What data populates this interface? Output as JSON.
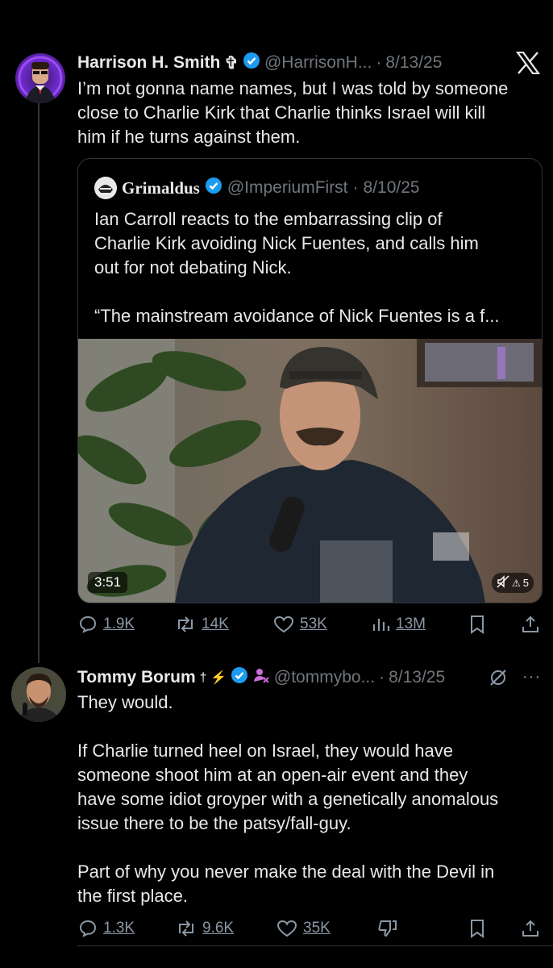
{
  "tweet1": {
    "name": "Harrison H. Smith",
    "name_glyph": "✞",
    "handle": "@HarrisonH...",
    "sep": "·",
    "date": "8/13/25",
    "text": "I’m not gonna name names, but I was told by someone\nclose to Charlie Kirk that Charlie thinks Israel will kill\nhim if he turns against them.",
    "quote": {
      "name": "Grimaldus",
      "handle": "@ImperiumFirst",
      "sep": "·",
      "date": "8/10/25",
      "text": "Ian Carroll reacts to the embarrassing clip of\nCharlie Kirk avoiding Nick Fuentes, and calls him\nout for not debating Nick.\n\n“The mainstream avoidance of Nick Fuentes is a f...",
      "video_duration": "3:51",
      "mute_count": "5"
    },
    "actions": {
      "replies": "1.9K",
      "reposts": "14K",
      "likes": "53K",
      "views": "13M"
    }
  },
  "tweet2": {
    "name": "Tommy Borum",
    "name_glyphs": "† ⚡",
    "handle": "@tommybo...",
    "sep": "·",
    "date": "8/13/25",
    "text": "They would.\n\nIf Charlie turned heel on Israel, they would have\nsomeone shoot him at an open-air event and they\nhave some idiot groyper with a genetically anomalous\nissue there to be the patsy/fall-guy.\n\nPart of why you never make the deal with the Devil in\nthe first place.",
    "actions": {
      "replies": "1.3K",
      "reposts": "9.6K",
      "likes": "35K"
    }
  },
  "colors": {
    "background": "#000000",
    "text": "#e7e9ea",
    "muted": "#71767b",
    "verified": "#1d9bf0",
    "affiliate": "#c86dd7"
  }
}
